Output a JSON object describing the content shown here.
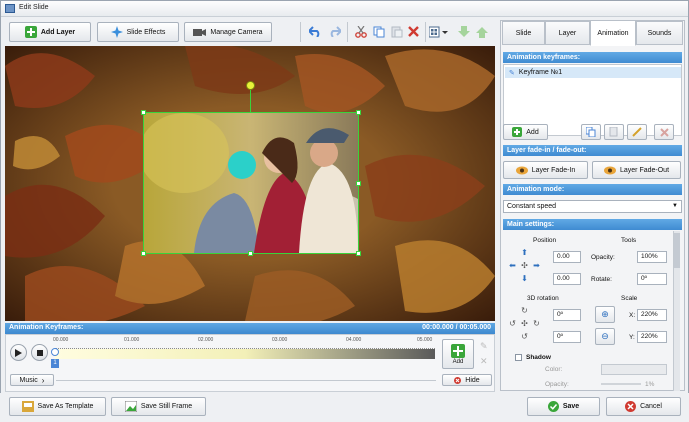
{
  "window": {
    "title": "Edit Slide"
  },
  "toolbar": {
    "add_layer": "Add Layer",
    "slide_effects": "Slide Effects",
    "manage_camera": "Manage Camera",
    "icons": [
      "undo-icon",
      "redo-icon",
      "cut-icon",
      "copy-icon",
      "paste-icon",
      "delete-icon",
      "grid-icon",
      "move-down-icon",
      "move-up-icon"
    ]
  },
  "tabs": [
    {
      "label": "Slide",
      "active": false
    },
    {
      "label": "Layer",
      "active": false
    },
    {
      "label": "Animation",
      "active": true
    },
    {
      "label": "Sounds",
      "active": false
    }
  ],
  "keyframes_panel": {
    "title": "Animation keyframes:",
    "items": [
      "Keyframe №1"
    ],
    "add_label": "Add"
  },
  "fade": {
    "title": "Layer fade-in / fade-out:",
    "fade_in": "Layer Fade-In",
    "fade_out": "Layer Fade-Out"
  },
  "mode": {
    "title": "Animation mode:",
    "value": "Constant speed"
  },
  "main_settings": {
    "title": "Main settings:",
    "position_label": "Position",
    "tools_label": "Tools",
    "pos_x": "0.00",
    "pos_y": "0.00",
    "opacity_label": "Opacity:",
    "opacity": "100%",
    "rotate_label": "Rotate:",
    "rotate": "0º",
    "rotation3d_label": "3D rotation",
    "scale_label": "Scale",
    "rot3d_x": "0º",
    "rot3d_y": "0º",
    "scale_x_label": "X:",
    "scale_x": "220%",
    "scale_y_label": "Y:",
    "scale_y": "220%",
    "shadow_label": "Shadow",
    "color_label": "Color:",
    "shadow_opacity_label": "Opacity:",
    "shadow_opacity": "1%"
  },
  "timeline": {
    "header": "Animation Keyframes:",
    "time": "00:00.000 / 00:05.000",
    "ticks": [
      "00.000",
      "01.000",
      "02.000",
      "03.000",
      "04.000",
      "05.000"
    ],
    "marker": "1",
    "add_label": "Add",
    "hide_label": "Hide",
    "music_label": "Music"
  },
  "bottom": {
    "save_template": "Save As Template",
    "save_still": "Save Still Frame",
    "save": "Save",
    "cancel": "Cancel"
  }
}
